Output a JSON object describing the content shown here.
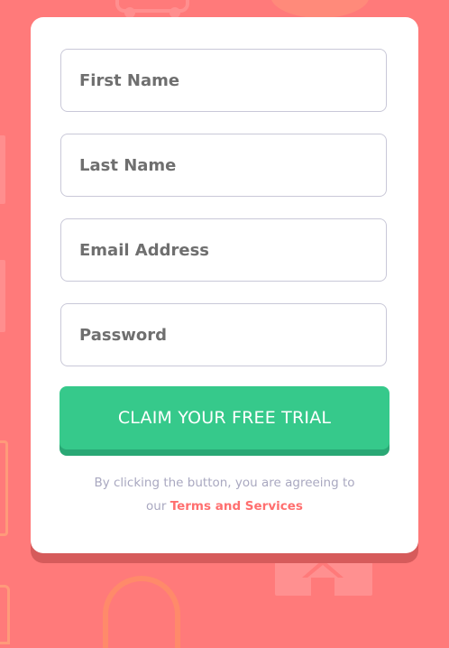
{
  "form": {
    "fields": [
      {
        "placeholder": "First Name",
        "value": ""
      },
      {
        "placeholder": "Last Name",
        "value": ""
      },
      {
        "placeholder": "Email Address",
        "value": ""
      },
      {
        "placeholder": "Password",
        "value": ""
      }
    ],
    "submit_label": "CLAIM YOUR FREE TRIAL",
    "legal_text_1": "By clicking the button, you are agreeing to",
    "legal_text_2": "our",
    "legal_link": "Terms and Services"
  },
  "colors": {
    "background": "#ff7a7a",
    "button": "#36c98b",
    "link": "#ff6f6f"
  },
  "icons": [
    "cart-icon",
    "home-icon",
    "headphones-icon"
  ]
}
